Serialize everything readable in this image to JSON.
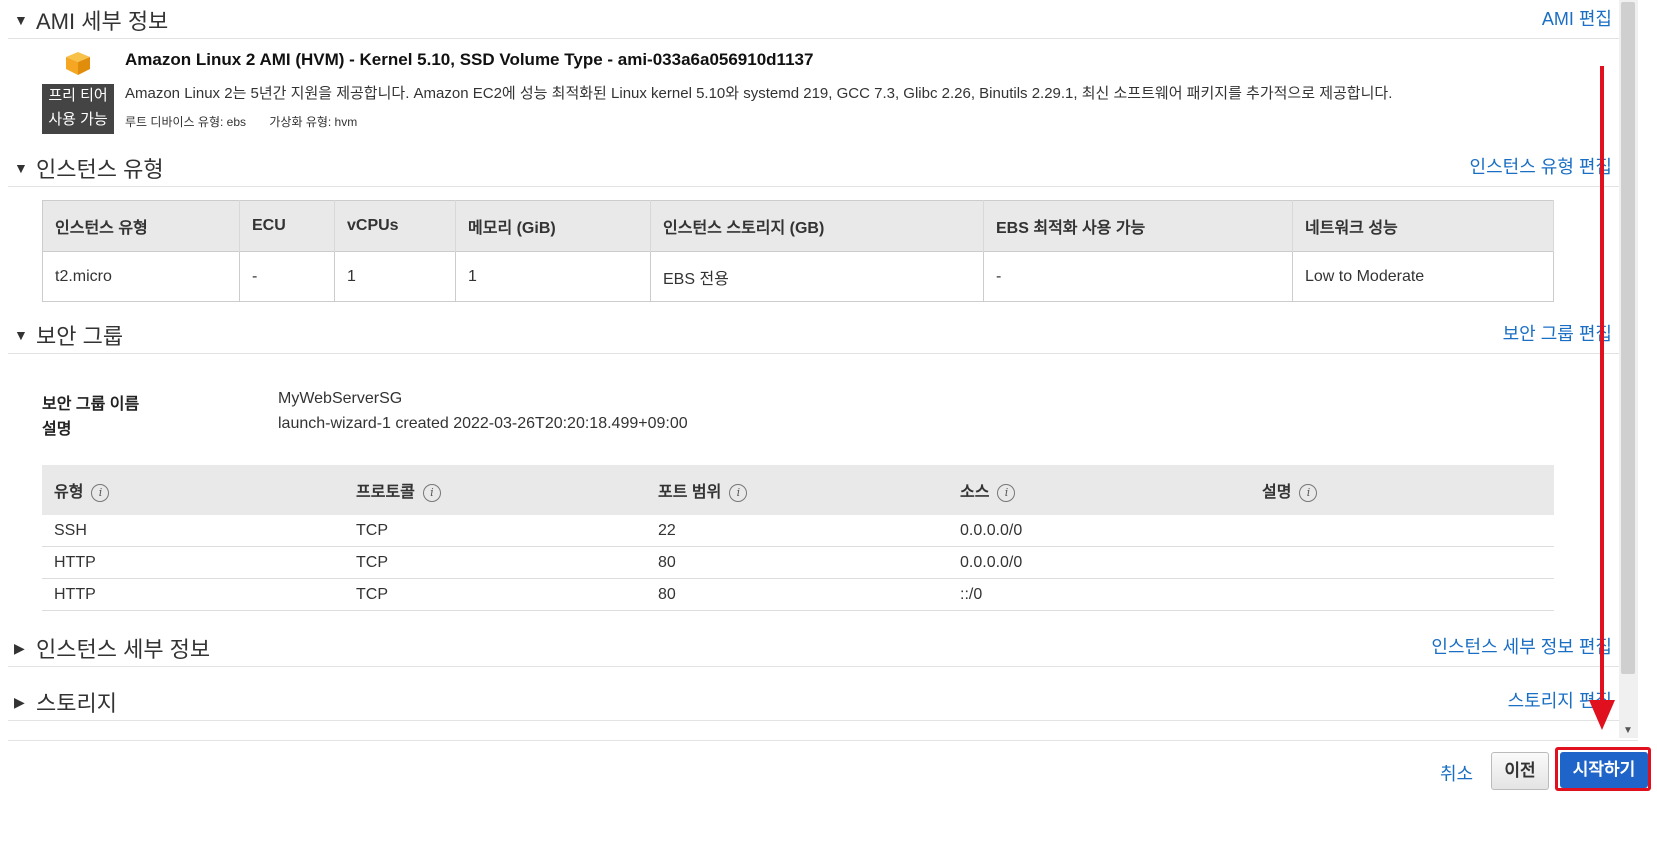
{
  "ami_section": {
    "title": "AMI 세부 정보",
    "edit_label": "AMI 편집",
    "ami_name": "Amazon Linux 2 AMI (HVM) - Kernel 5.10, SSD Volume Type - ami-033a6a056910d1137",
    "tier_line1": "프리 티어",
    "tier_line2": "사용 가능",
    "description": "Amazon Linux 2는 5년간 지원을 제공합니다. Amazon EC2에 성능 최적화된 Linux kernel 5.10와 systemd 219, GCC 7.3, Glibc 2.26, Binutils 2.29.1, 최신 소프트웨어 패키지를 추가적으로 제공합니다.",
    "root_device": "루트 디바이스 유형: ebs",
    "virtualization": "가상화 유형: hvm",
    "icon": "package-icon"
  },
  "instance_type_section": {
    "title": "인스턴스 유형",
    "edit_label": "인스턴스 유형 편집",
    "headers": [
      "인스턴스 유형",
      "ECU",
      "vCPUs",
      "메모리 (GiB)",
      "인스턴스 스토리지 (GB)",
      "EBS 최적화 사용 가능",
      "네트워크 성능"
    ],
    "row": [
      "t2.micro",
      "-",
      "1",
      "1",
      "EBS 전용",
      "-",
      "Low to Moderate"
    ]
  },
  "security_group_section": {
    "title": "보안 그룹",
    "edit_label": "보안 그룹 편집",
    "name_label": "보안 그룹 이름",
    "name_value": "MyWebServerSG",
    "desc_label": "설명",
    "desc_value": "launch-wizard-1 created 2022-03-26T20:20:18.499+09:00",
    "rule_headers": [
      "유형",
      "프로토콜",
      "포트 범위",
      "소스",
      "설명"
    ],
    "info_symbol": "i",
    "rules": [
      {
        "type": "SSH",
        "protocol": "TCP",
        "port": "22",
        "source": "0.0.0.0/0",
        "desc": ""
      },
      {
        "type": "HTTP",
        "protocol": "TCP",
        "port": "80",
        "source": "0.0.0.0/0",
        "desc": ""
      },
      {
        "type": "HTTP",
        "protocol": "TCP",
        "port": "80",
        "source": "::/0",
        "desc": ""
      }
    ]
  },
  "instance_details_section": {
    "title": "인스턴스 세부 정보",
    "edit_label": "인스턴스 세부 정보 편집"
  },
  "storage_section": {
    "title": "스토리지",
    "edit_label": "스토리지 편집"
  },
  "footer": {
    "cancel_label": "취소",
    "previous_label": "이전",
    "launch_label": "시작하기"
  },
  "colors": {
    "link": "#1a6fc4",
    "primary_button": "#1f64c8",
    "annotation_red": "#e0101e",
    "ami_icon": "#f5a623"
  }
}
